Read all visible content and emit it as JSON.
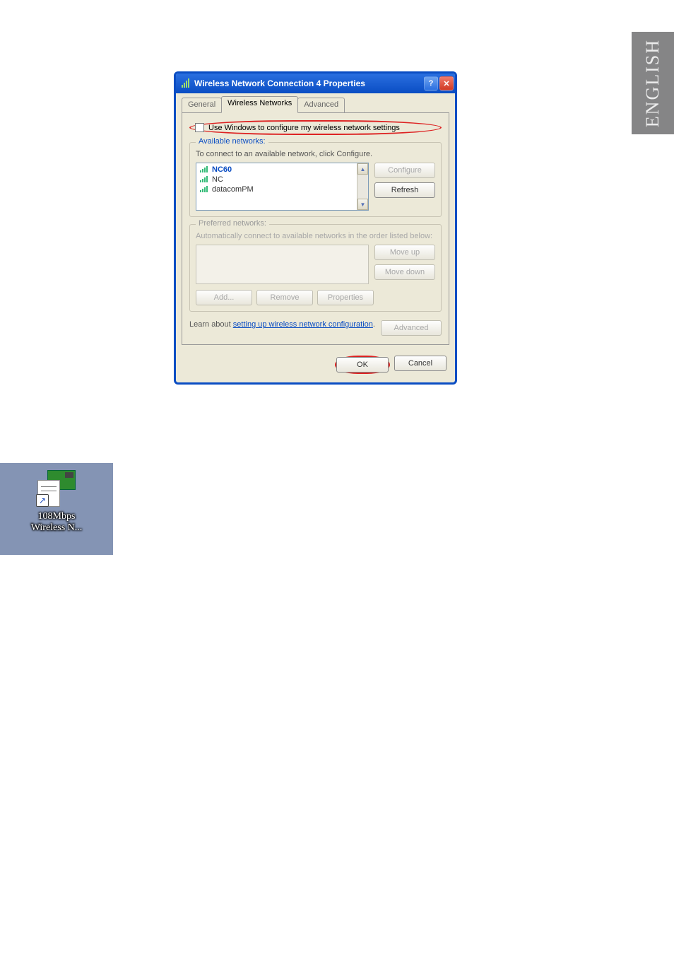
{
  "side_tab": {
    "label": "ENGLISH"
  },
  "dialog": {
    "title": "Wireless Network Connection 4 Properties",
    "tabs": [
      "General",
      "Wireless Networks",
      "Advanced"
    ],
    "checkbox_label": "Use Windows to configure my wireless network settings",
    "available": {
      "legend": "Available networks:",
      "hint": "To connect to an available network, click Configure.",
      "items": [
        "NC60",
        "NC",
        "datacomPM"
      ],
      "buttons": {
        "configure": "Configure",
        "refresh": "Refresh"
      }
    },
    "preferred": {
      "legend": "Preferred networks:",
      "hint": "Automatically connect to available networks in the order listed below:",
      "buttons": {
        "moveup": "Move up",
        "movedown": "Move down",
        "add": "Add...",
        "remove": "Remove",
        "props": "Properties"
      }
    },
    "learn": {
      "prefix": "Learn about ",
      "link": "setting up wireless network configuration",
      "suffix": "."
    },
    "advanced_btn": "Advanced",
    "ok": "OK",
    "cancel": "Cancel"
  },
  "desktop_icon": {
    "line1": "108Mbps",
    "line2": "Wireless N..."
  }
}
